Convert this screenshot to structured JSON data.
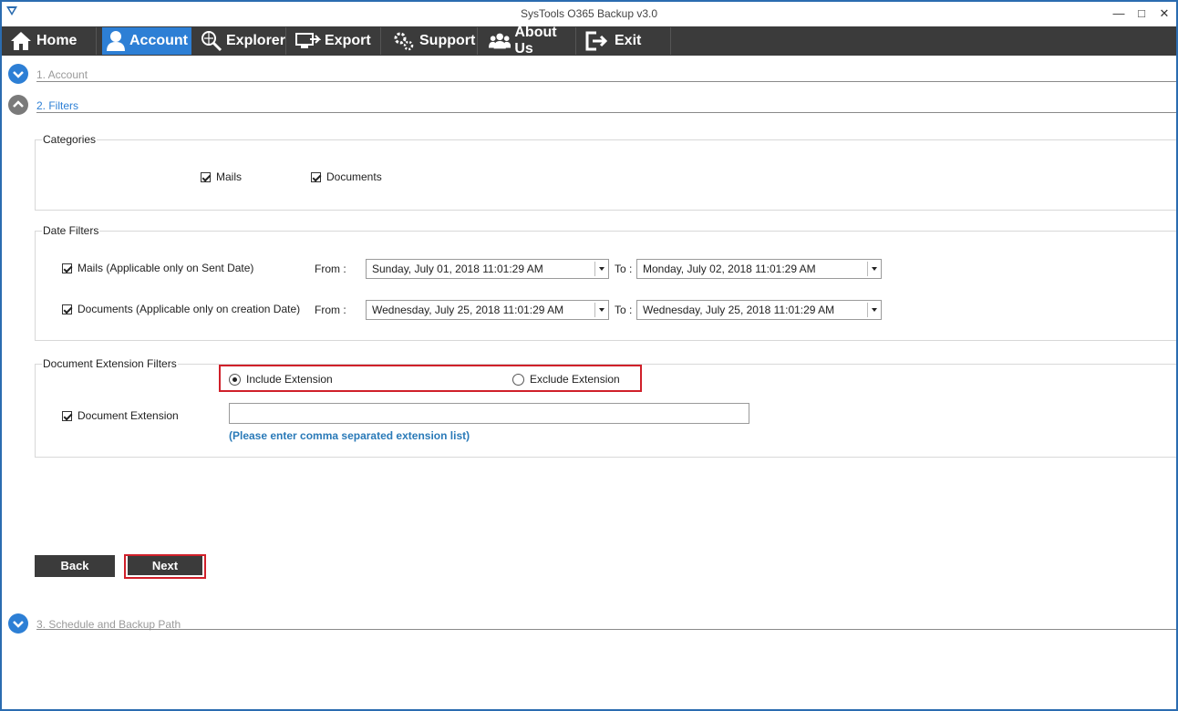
{
  "window": {
    "title": "SysTools O365 Backup v3.0"
  },
  "menu": {
    "home": "Home",
    "account": "Account",
    "explorer": "Explorer",
    "export": "Export",
    "support": "Support",
    "about": "About Us",
    "exit": "Exit",
    "active": "Account"
  },
  "sections": {
    "account": "1. Account",
    "filters": "2. Filters",
    "schedule": "3. Schedule and Backup Path"
  },
  "categories": {
    "title": "Categories",
    "mails": {
      "label": "Mails",
      "checked": true
    },
    "documents": {
      "label": "Documents",
      "checked": true
    }
  },
  "date_filters": {
    "title": "Date Filters",
    "mails": {
      "label": "Mails (Applicable only on Sent Date)",
      "checked": true,
      "from_label": "From :",
      "from": "Sunday, July  01, 2018 11:01:29 AM",
      "to_label": "To :",
      "to": "Monday, July  02, 2018 11:01:29 AM"
    },
    "documents": {
      "label": "Documents (Applicable only on creation Date)",
      "checked": true,
      "from_label": "From :",
      "from": "Wednesday, July  25, 2018 11:01:29 AM",
      "to_label": "To :",
      "to": "Wednesday, July  25, 2018 11:01:29 AM"
    }
  },
  "extension_filters": {
    "title": "Document Extension Filters",
    "include": {
      "label": "Include Extension",
      "selected": true
    },
    "exclude": {
      "label": "Exclude Extension",
      "selected": false
    },
    "document_extension": {
      "label": "Document Extension",
      "checked": true,
      "value": ""
    },
    "hint": "(Please enter comma separated extension list)"
  },
  "buttons": {
    "back": "Back",
    "next": "Next"
  },
  "colors": {
    "accent": "#2d7fd5",
    "menubar": "#3b3b3b",
    "highlight": "#d0202a",
    "hint": "#2a7ab8"
  },
  "icons": [
    "home-icon",
    "user-icon",
    "explorer-icon",
    "export-icon",
    "support-icon",
    "users-icon",
    "exit-icon"
  ]
}
